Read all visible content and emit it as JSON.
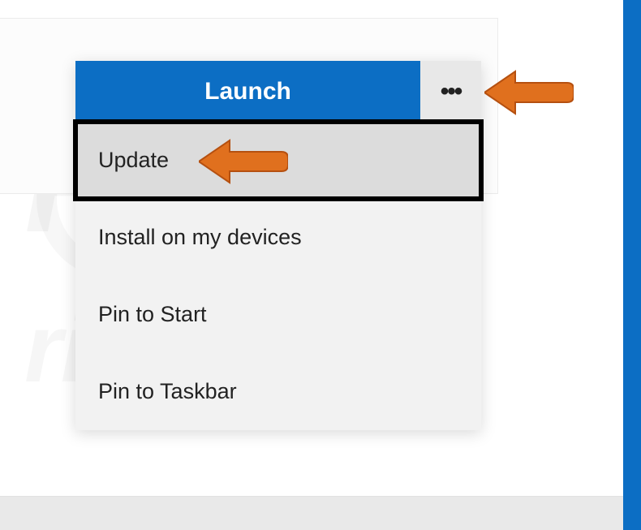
{
  "launch": {
    "label": "Launch",
    "more_label": "•••"
  },
  "menu": {
    "items": [
      {
        "label": "Update",
        "highlighted": true
      },
      {
        "label": "Install on my devices",
        "highlighted": false
      },
      {
        "label": "Pin to Start",
        "highlighted": false
      },
      {
        "label": "Pin to Taskbar",
        "highlighted": false
      }
    ]
  },
  "colors": {
    "accent": "#0c6ec4",
    "highlight_bg": "#dcdcdc",
    "menu_bg": "#f2f2f2",
    "arrow": "#e0701e"
  }
}
